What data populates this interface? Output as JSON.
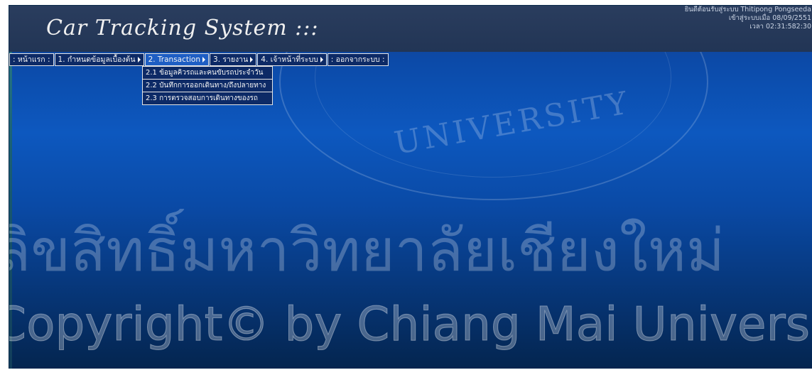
{
  "header": {
    "title": "Car Tracking System :::",
    "welcome_line1": "ยินดีต้อนรับสู่ระบบ Thitipong Pongseeda",
    "welcome_line2": "เข้าสู่ระบบเมื่อ 08/09/2551",
    "welcome_line3": "เวลา 02:31:582:30"
  },
  "menu": {
    "items": [
      {
        "label": ": หน้าแรก :",
        "has_arrow": false
      },
      {
        "label": "1. กำหนดข้อมูลเบื้องต้น",
        "has_arrow": true
      },
      {
        "label": "2. Transaction",
        "has_arrow": true,
        "active": true
      },
      {
        "label": "3. รายงาน",
        "has_arrow": true
      },
      {
        "label": "4. เจ้าหน้าที่ระบบ",
        "has_arrow": true
      },
      {
        "label": ": ออกจากระบบ :",
        "has_arrow": false
      }
    ]
  },
  "submenu": {
    "items": [
      {
        "label": "2.1 ข้อมูลคิวรถและคนขับรถประจำวัน"
      },
      {
        "label": "2.2 บันทึกการออกเดินทาง/ถึงปลายทาง"
      },
      {
        "label": "2.3 การตรวจสอบการเดินทางของรถ"
      }
    ]
  },
  "watermark": {
    "university_text": "UNIVERSITY",
    "thai_text": "ลิขสิทธิ์มหาวิทยาลัยเชียงใหม่",
    "copyright_text": "Copyright© by Chiang Mai University"
  }
}
